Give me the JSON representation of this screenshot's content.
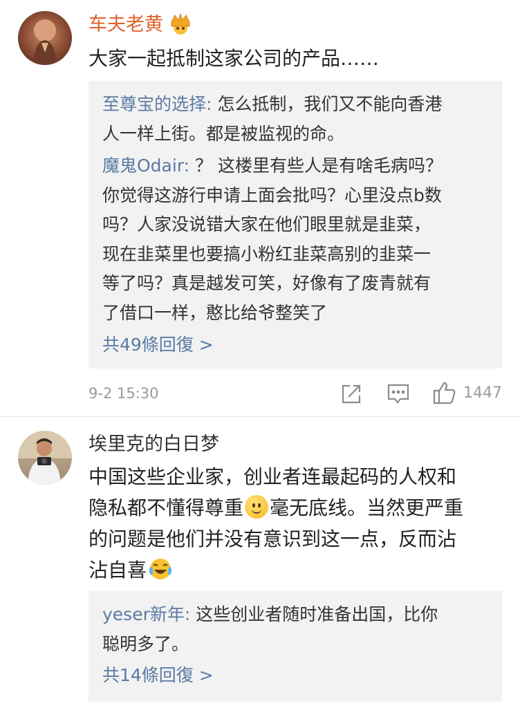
{
  "comments": [
    {
      "username": "车夫老黄",
      "badge_icon": "crown-icon",
      "text": "大家一起抵制这家公司的产品……",
      "replies": [
        {
          "user": "至尊宝的选择",
          "lines": [
            "怎么抵制，我们又不能向香港",
            "人一样上街。都是被监视的命。"
          ]
        },
        {
          "user": "魔鬼Odair",
          "lines": [
            "？ 这楼里有些人是有啥毛病吗？",
            "你觉得这游行申请上面会批吗？心里没点b数",
            "吗？人家没说错大家在他们眼里就是韭菜，",
            "现在韭菜里也要搞小粉红韭菜高别的韭菜一",
            "等了吗？真是越发可笑，好像有了废青就有",
            "了借口一样，憨比给爷整笑了"
          ]
        }
      ],
      "more_replies": "共49條回復 >",
      "timestamp": "9-2 15:30",
      "likes": "1447"
    },
    {
      "username": "埃里克的白日梦",
      "text_lines": [
        "中国这些企业家，创业者连最起码的人权和",
        "隐私都不懂得尊重",
        "毫无底线。当然更严重",
        "的问题是他们并没有意识到这一点，反而沾",
        "沾自喜"
      ],
      "replies": [
        {
          "user": "yeser新年",
          "lines": [
            "这些创业者随时准备出国，比你",
            "聪明多了。"
          ]
        }
      ],
      "more_replies": "共14條回復 >"
    }
  ],
  "colors": {
    "username_orange": "#e0612b",
    "reply_user_blue": "#5b7aa3",
    "reply_bg": "#f2f2f2"
  }
}
